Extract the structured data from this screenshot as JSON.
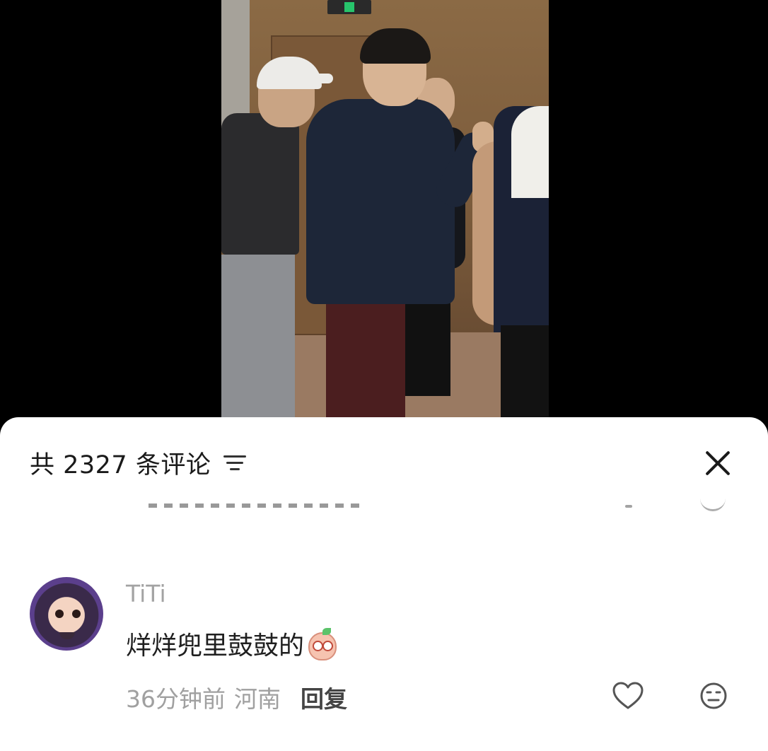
{
  "comments_panel": {
    "count_label": "共 2327 条评论"
  },
  "comments": [
    {
      "username": "TiTi",
      "text": "烊烊兜里鼓鼓的",
      "time": "36分钟前",
      "location": "河南",
      "reply_label": "回复"
    }
  ],
  "icons": {
    "sort": "sort-icon",
    "close": "close-icon",
    "like": "heart-icon",
    "dislike": "neutral-face-icon",
    "emoji": "peach-emoji-icon"
  }
}
